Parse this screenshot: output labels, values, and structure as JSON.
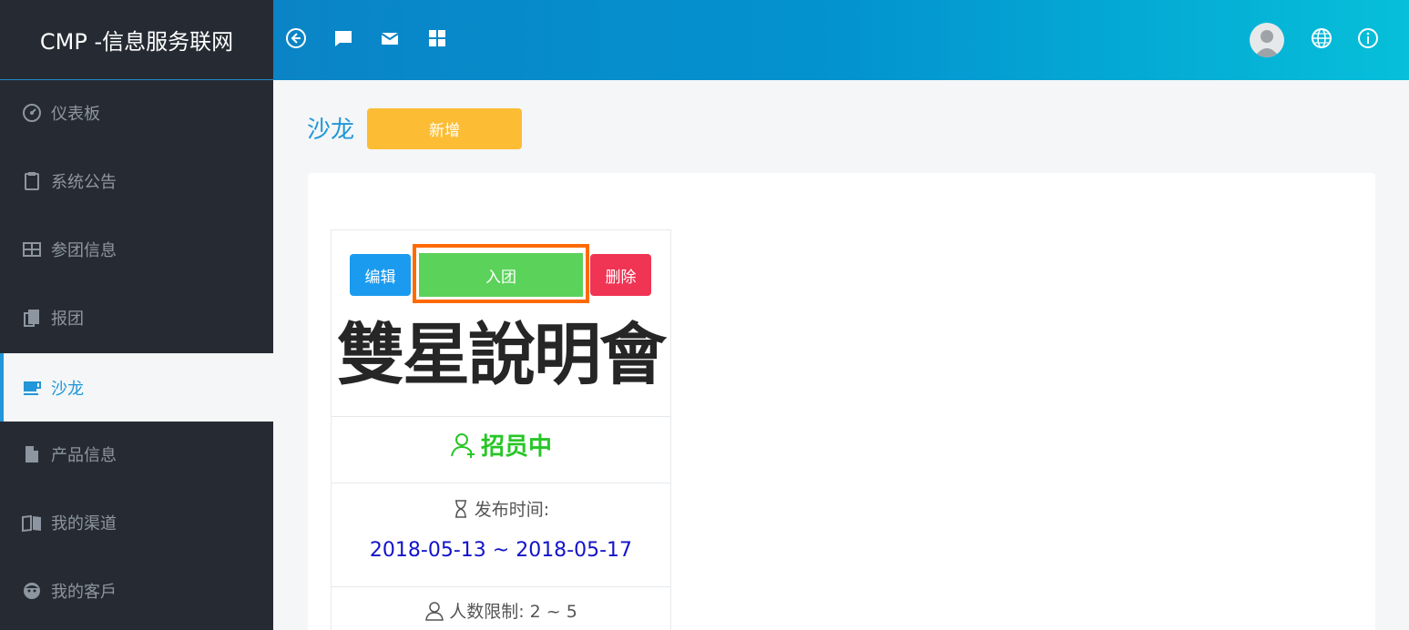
{
  "app": {
    "title": "CMP -信息服务联网"
  },
  "topbar": {
    "icons": [
      "back-circle-icon",
      "chat-icon",
      "mail-icon",
      "grid-icon",
      "avatar",
      "globe-icon",
      "info-icon"
    ]
  },
  "sidebar": {
    "items": [
      {
        "label": "仪表板",
        "icon": "dashboard-icon"
      },
      {
        "label": "系统公告",
        "icon": "clipboard-icon"
      },
      {
        "label": "参团信息",
        "icon": "table-icon"
      },
      {
        "label": "报团",
        "icon": "book-stack-icon"
      },
      {
        "label": "沙龙",
        "icon": "cup-icon",
        "active": true
      },
      {
        "label": "产品信息",
        "icon": "document-icon"
      },
      {
        "label": "我的渠道",
        "icon": "open-book-icon"
      },
      {
        "label": "我的客戶",
        "icon": "face-icon"
      }
    ]
  },
  "main": {
    "title": "沙龙",
    "add_label": "新增",
    "card": {
      "edit_label": "编辑",
      "join_label": "入团",
      "delete_label": "删除",
      "title": "雙星說明會",
      "status": "招员中",
      "publish_label": "发布时间:",
      "publish_range": "2018-05-13 ~ 2018-05-17",
      "limit_label": "人数限制: 2 ~ 5"
    }
  },
  "colors": {
    "sidebar_bg": "#262b33",
    "accent": "#2196d8",
    "add_button": "#fcbd35",
    "edit_button": "#1a9bf0",
    "join_button": "#5bd25a",
    "delete_button": "#f03454",
    "status_green": "#27c627",
    "date_blue": "#1313c8",
    "highlight_outline": "#ff6a00"
  }
}
